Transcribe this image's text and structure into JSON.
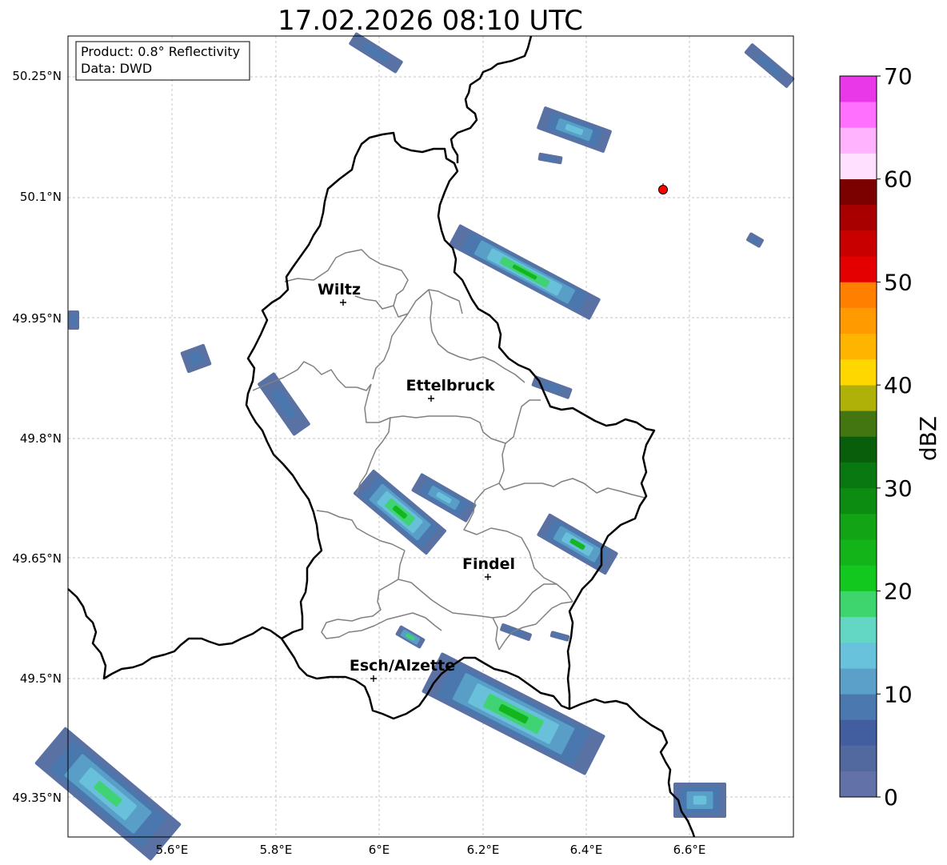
{
  "title": "17.02.2026 08:10 UTC",
  "info_box": {
    "line1": "Product: 0.8° Reflectivity",
    "line2": "Data: DWD"
  },
  "axes": {
    "lon_ticks": [
      "5.6°E",
      "5.8°E",
      "6°E",
      "6.2°E",
      "6.4°E",
      "6.6°E"
    ],
    "lat_ticks": [
      "50.25°N",
      "50.1°N",
      "49.95°N",
      "49.8°N",
      "49.65°N",
      "49.5°N",
      "49.35°N"
    ]
  },
  "cities": [
    {
      "name": "Wiltz"
    },
    {
      "name": "Ettelbruck"
    },
    {
      "name": "Findel"
    },
    {
      "name": "Esch/Alzette"
    }
  ],
  "colorbar": {
    "label": "dBZ",
    "ticks": [
      "0",
      "10",
      "20",
      "30",
      "40",
      "50",
      "60",
      "70"
    ],
    "colors": [
      "#6272a8",
      "#51699e",
      "#435e9f",
      "#4a78af",
      "#5aa0c8",
      "#69c2dc",
      "#64d6c4",
      "#3ed46e",
      "#12c81e",
      "#12b41a",
      "#12a414",
      "#0c8c10",
      "#0a7810",
      "#095e0c",
      "#437510",
      "#afb108",
      "#ffd700",
      "#ffb400",
      "#ff9a00",
      "#ff8000",
      "#e40000",
      "#c80000",
      "#a80000",
      "#7b0000",
      "#ffe0ff",
      "#ffb3ff",
      "#ff70ff",
      "#e838e8"
    ]
  },
  "colors": {
    "border": "#000000",
    "districts": "#808080",
    "grid": "#b0b0b0",
    "marker": "#ff0000"
  }
}
